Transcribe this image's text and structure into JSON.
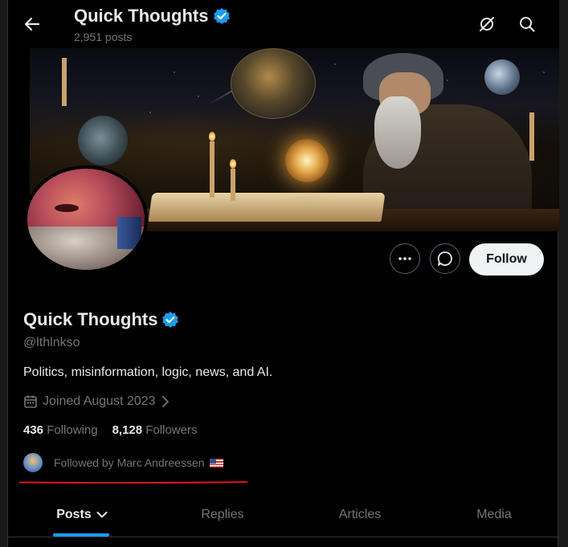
{
  "header": {
    "title": "Quick Thoughts",
    "posts_count": "2,951 posts"
  },
  "profile": {
    "name": "Quick Thoughts",
    "handle": "@lthlnkso",
    "bio": "Politics, misinformation, logic, news, and AI.",
    "joined": "Joined August 2023",
    "following_count": "436",
    "following_label": "Following",
    "followers_count": "8,128",
    "followers_label": "Followers",
    "followed_by": "Followed by Marc Andreessen"
  },
  "actions": {
    "follow_label": "Follow"
  },
  "tabs": [
    {
      "label": "Posts"
    },
    {
      "label": "Replies"
    },
    {
      "label": "Articles"
    },
    {
      "label": "Media"
    }
  ],
  "colors": {
    "verified": "#1d9bf0",
    "annotation_line": "#e0141c",
    "tab_indicator": "#1d9bf0"
  },
  "icons": [
    "back-arrow-icon",
    "verified-badge-icon",
    "grok-icon",
    "search-icon",
    "more-icon",
    "message-icon",
    "calendar-icon",
    "chevron-right-icon",
    "chevron-down-icon",
    "us-flag-icon"
  ]
}
